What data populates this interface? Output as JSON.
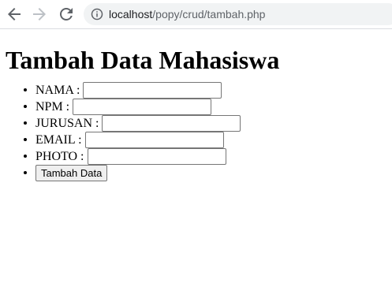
{
  "browser": {
    "url_host": "localhost",
    "url_path": "/popy/crud/tambah.php"
  },
  "page": {
    "title": "Tambah Data Mahasiswa"
  },
  "form": {
    "fields": [
      {
        "label": "NAMA :",
        "value": ""
      },
      {
        "label": "NPM :",
        "value": ""
      },
      {
        "label": "JURUSAN :",
        "value": ""
      },
      {
        "label": "EMAIL :",
        "value": ""
      },
      {
        "label": "PHOTO :",
        "value": ""
      }
    ],
    "submit_label": "Tambah Data"
  }
}
